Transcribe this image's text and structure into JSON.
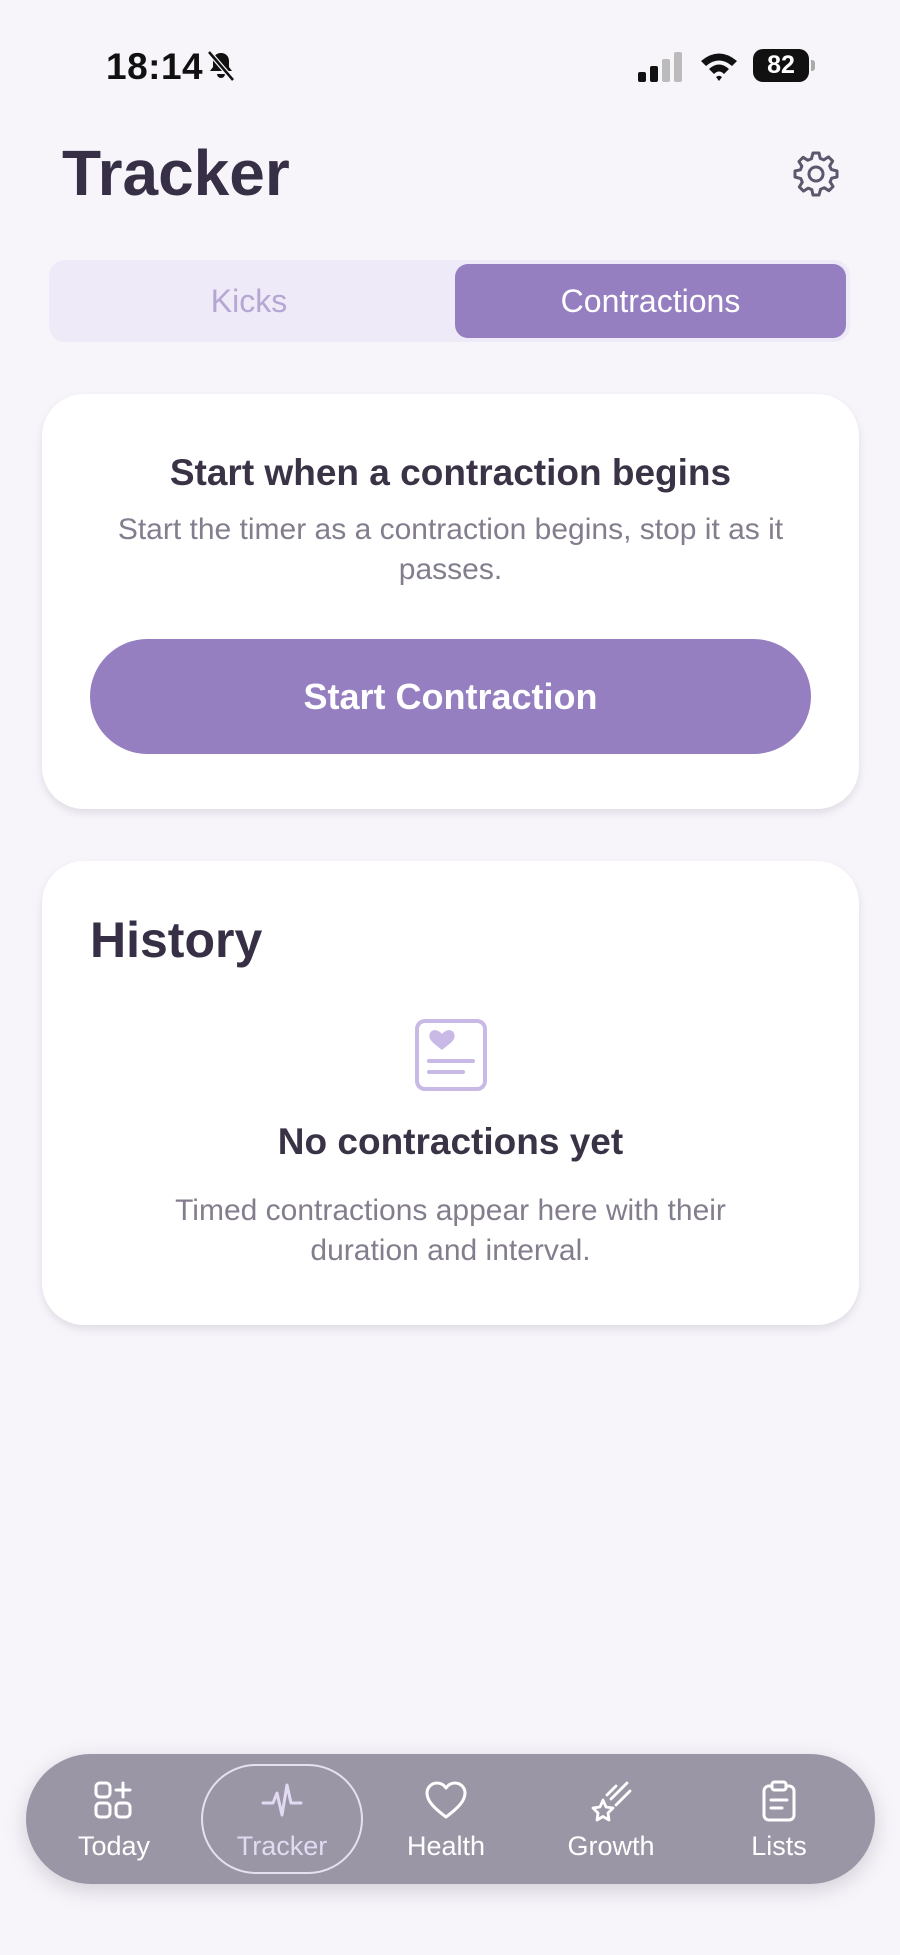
{
  "status_bar": {
    "time": "18:14",
    "battery": "82"
  },
  "header": {
    "title": "Tracker"
  },
  "segments": {
    "kicks": "Kicks",
    "contractions": "Contractions",
    "selected": "Contractions"
  },
  "contraction_card": {
    "title": "Start when a contraction begins",
    "description": "Start the timer as a contraction begins, stop it as it passes.",
    "button": "Start Contraction"
  },
  "history_card": {
    "title": "History",
    "empty_title": "No contractions yet",
    "empty_description": "Timed contractions appear here with their duration and interval."
  },
  "tab_bar": {
    "items": [
      {
        "label": "Today",
        "icon": "grid-plus-icon"
      },
      {
        "label": "Tracker",
        "icon": "pulse-icon",
        "selected": true
      },
      {
        "label": "Health",
        "icon": "heart-icon"
      },
      {
        "label": "Growth",
        "icon": "shooting-star-icon"
      },
      {
        "label": "Lists",
        "icon": "clipboard-icon"
      }
    ]
  },
  "colors": {
    "accent": "#957fc1",
    "background": "#f7f5fa",
    "tab_bar": "#9a96a5"
  }
}
